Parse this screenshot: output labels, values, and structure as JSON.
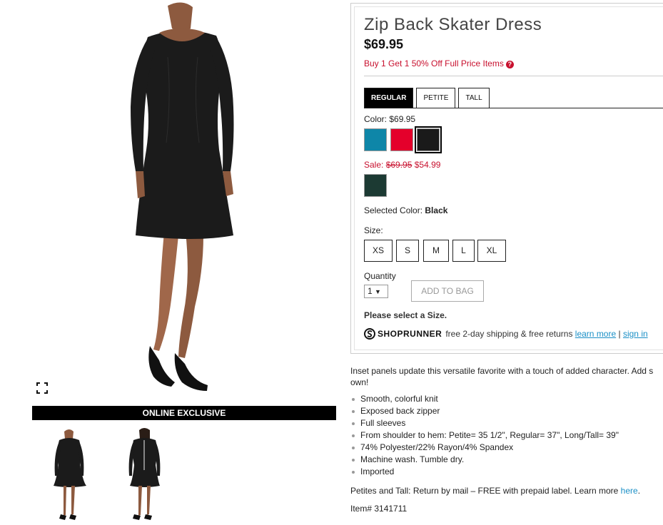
{
  "product": {
    "title": "Zip Back Skater Dress",
    "price": "$69.95",
    "promo": "Buy 1 Get 1 50% Off Full Price Items",
    "promo_icon": "question-circle-icon",
    "badge": "ONLINE EXCLUSIVE"
  },
  "fit_tabs": [
    {
      "label": "REGULAR",
      "active": true
    },
    {
      "label": "PETITE",
      "active": false
    },
    {
      "label": "TALL",
      "active": false
    }
  ],
  "colors": {
    "label": "Color:",
    "price": "$69.95",
    "swatches": [
      {
        "name": "Teal",
        "hex": "#0e86a8"
      },
      {
        "name": "Red",
        "hex": "#e4002b"
      },
      {
        "name": "Black",
        "hex": "#1a1a1a",
        "selected": true
      }
    ],
    "sale_label": "Sale:",
    "sale_original": "$69.95",
    "sale_price": "$54.99",
    "sale_swatches": [
      {
        "name": "Dark Green",
        "hex": "#1c3a33"
      }
    ],
    "selected_label": "Selected Color:",
    "selected_value": "Black"
  },
  "sizes": {
    "label": "Size:",
    "options": [
      "XS",
      "S",
      "M",
      "L",
      "XL"
    ]
  },
  "quantity": {
    "label": "Quantity",
    "value": "1",
    "arrow": "▼"
  },
  "add_to_bag": "ADD TO BAG",
  "select_message": "Please select a Size.",
  "shoprunner": {
    "brand": "SHOPRUNNER",
    "text": "free 2-day shipping & free returns",
    "learn_more": "learn more",
    "separator": "|",
    "sign_in": "sign in"
  },
  "description": "Inset panels update this versatile favorite with a touch of added character. Add s own!",
  "bullets": [
    "Smooth, colorful knit",
    "Exposed back zipper",
    "Full sleeves",
    "From shoulder to hem: Petite= 35 1/2\", Regular= 37\", Long/Tall= 39\"",
    "74% Polyester/22% Rayon/4% Spandex",
    "Machine wash. Tumble dry.",
    "Imported"
  ],
  "returns": {
    "text": "Petites and Tall: Return by mail – FREE with prepaid label. Learn more",
    "link": "here",
    "end": "."
  },
  "item_number": "Item# 3141711",
  "colors_theme": {
    "accent_red": "#c8102e",
    "link_blue": "#1a8fc6"
  }
}
